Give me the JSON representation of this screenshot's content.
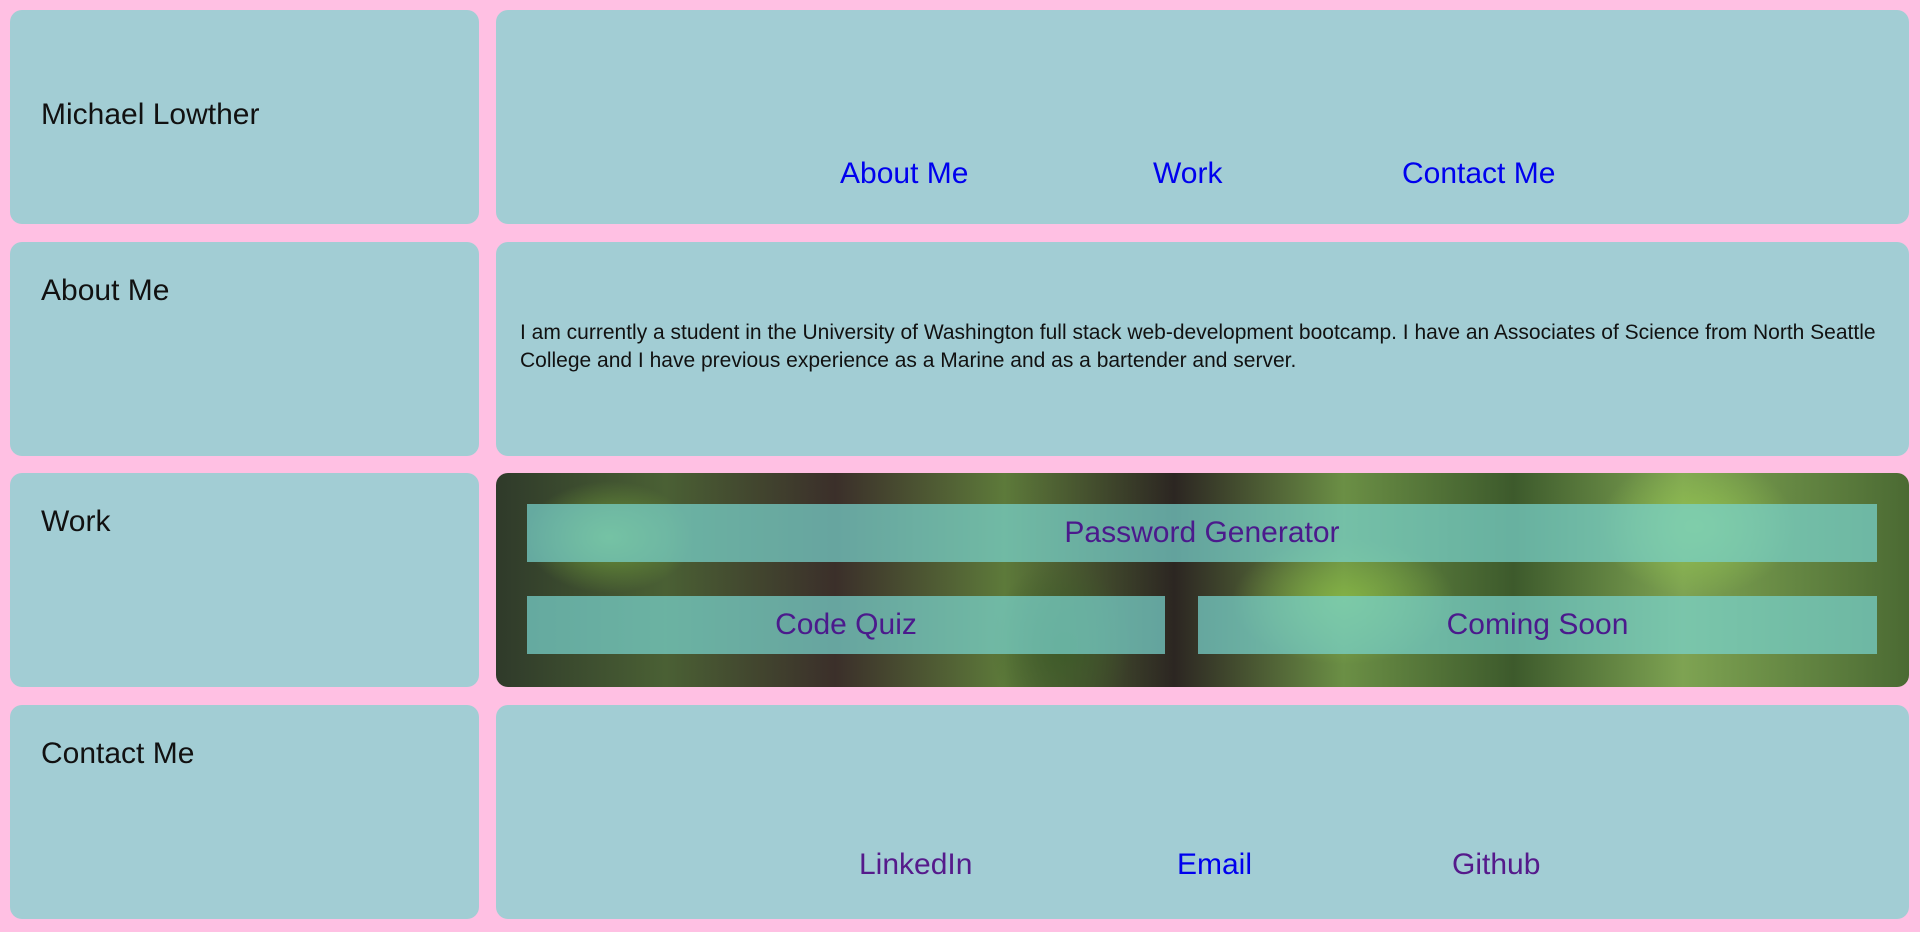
{
  "header": {
    "name": "Michael Lowther",
    "nav": [
      "About Me",
      "Work",
      "Contact Me"
    ]
  },
  "about": {
    "title": "About Me",
    "text": "I am currently a student in the University of Washington full stack web-development bootcamp. I have an Associates of Science from North Seattle College and I have previous experience as a Marine and as a bartender and server."
  },
  "work": {
    "title": "Work",
    "projects": [
      "Password Generator",
      "Code Quiz",
      "Coming Soon"
    ]
  },
  "contact": {
    "title": "Contact Me",
    "links": [
      "LinkedIn",
      "Email",
      "Github"
    ]
  },
  "colors": {
    "page_background": "#ffc0e3",
    "panel_background": "#a2cdd4",
    "link_blue": "#0000ee",
    "link_visited_purple": "#551a8b",
    "tile_background": "rgba(120,210,205,0.72)"
  }
}
